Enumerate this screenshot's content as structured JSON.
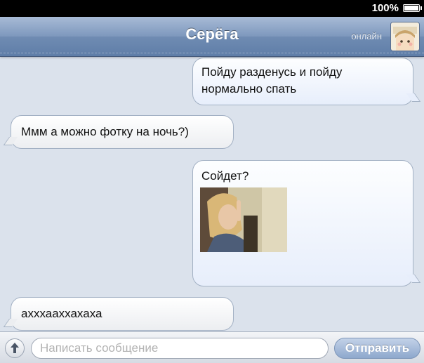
{
  "status_bar": {
    "battery": "100%"
  },
  "header": {
    "title": "Серёга",
    "status": "онлайн"
  },
  "messages": [
    {
      "direction": "outgoing",
      "text": "Пойду разденусь и пойду нормально спать"
    },
    {
      "direction": "incoming",
      "text": "Ммм а можно фотку на ночь?)"
    },
    {
      "direction": "outgoing",
      "text": "Сойдет?",
      "attachment": "photo"
    },
    {
      "direction": "incoming",
      "text": "ахххааххахаха"
    }
  ],
  "composer": {
    "placeholder": "Написать сообщение",
    "value": "",
    "send_label": "Отправить"
  },
  "icons": {
    "attach": "upload-arrow-icon",
    "battery": "battery-icon"
  },
  "colors": {
    "nav": "#7f99be",
    "chat_bg": "#dbe2ec",
    "send": "#8ea8cd"
  }
}
